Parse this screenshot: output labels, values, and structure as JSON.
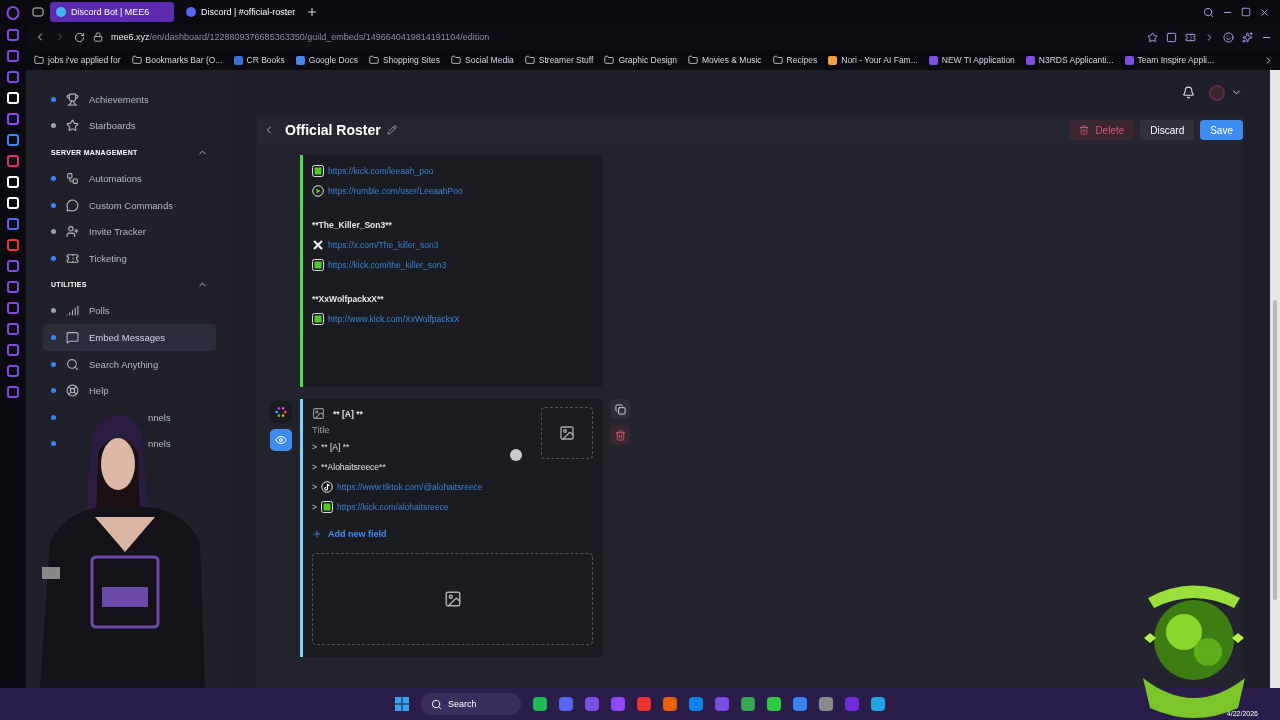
{
  "browser": {
    "tabs": [
      {
        "label": "Discord Bot | MEE6",
        "selected": true
      },
      {
        "label": "Discord | #official-roster",
        "selected": false
      }
    ],
    "url": {
      "host": "mee6.xyz",
      "path": "/en/dashboard/1228809376685363350/guild_embeds/1496640419814191104/edition"
    },
    "bookmarks": [
      {
        "label": "jobs i've applied for",
        "kind": "folder"
      },
      {
        "label": "Bookmarks Bar (O...",
        "kind": "folder"
      },
      {
        "label": "CR Books",
        "kind": "site"
      },
      {
        "label": "Google Docs",
        "kind": "site"
      },
      {
        "label": "Shopping Sites",
        "kind": "folder"
      },
      {
        "label": "Social Media",
        "kind": "folder"
      },
      {
        "label": "Streamer Stuff",
        "kind": "folder"
      },
      {
        "label": "Graphic Design",
        "kind": "folder"
      },
      {
        "label": "Movies & Music",
        "kind": "folder"
      },
      {
        "label": "Recipes",
        "kind": "folder"
      },
      {
        "label": "Nori - Your AI Fam...",
        "kind": "site"
      },
      {
        "label": "NEW TI Application",
        "kind": "site"
      },
      {
        "label": "N3RDS Applicanti...",
        "kind": "site"
      },
      {
        "label": "Team Inspire Appli...",
        "kind": "site"
      }
    ]
  },
  "sidebar": [
    {
      "kind": "item",
      "label": "Achievements",
      "color": "#3b82f6",
      "selected": false
    },
    {
      "kind": "item",
      "label": "Starboards",
      "color": "#9ca3af",
      "selected": false
    },
    {
      "kind": "section",
      "title": "SERVER MANAGEMENT",
      "expanded": true
    },
    {
      "kind": "item",
      "label": "Automations",
      "color": "#3b82f6",
      "selected": false
    },
    {
      "kind": "item",
      "label": "Custom Commands",
      "color": "#3b82f6",
      "selected": false
    },
    {
      "kind": "item",
      "label": "Invite Tracker",
      "color": "#9ca3af",
      "selected": false
    },
    {
      "kind": "item",
      "label": "Ticketing",
      "color": "#3b82f6",
      "selected": false
    },
    {
      "kind": "section",
      "title": "UTILITIES",
      "expanded": true
    },
    {
      "kind": "item",
      "label": "Polls",
      "color": "#9ca3af",
      "selected": false
    },
    {
      "kind": "item",
      "label": "Embed Messages",
      "color": "#3b82f6",
      "selected": true
    },
    {
      "kind": "item",
      "label": "Search Anything",
      "color": "#3b82f6",
      "selected": false
    },
    {
      "kind": "item",
      "label": "Help",
      "color": "#3b82f6",
      "selected": false
    },
    {
      "kind": "covered",
      "label": "nnels",
      "color": "#3b82f6",
      "selected": false
    },
    {
      "kind": "covered",
      "label": "nnels",
      "color": "#3b82f6",
      "selected": false
    }
  ],
  "page": {
    "title": "Official Roster",
    "actions": [
      {
        "label": "Delete",
        "kind": "danger"
      },
      {
        "label": "Discard",
        "kind": "secondary"
      },
      {
        "label": "Save",
        "kind": "primary"
      }
    ],
    "embeds": [
      {
        "color": "#4ade50",
        "lines": [
          {
            "kind": "kick",
            "text": "https://kick.com/leeaah_poo"
          },
          {
            "kind": "rumble",
            "text": "https://rumble.com/user/LeeaahPoo"
          },
          {
            "kind": "heading",
            "text": "**The_Killer_Son3**"
          },
          {
            "kind": "x",
            "text": "https://x.com/The_killer_son3"
          },
          {
            "kind": "kick",
            "text": "https://kick.com/the_killer_son3"
          },
          {
            "kind": "heading",
            "text": "**XxWolfpackxX**"
          },
          {
            "kind": "kick",
            "text": "http://www.kick.com/XxWolfpackxX"
          }
        ]
      },
      {
        "color": "#7dd3fc",
        "author": "** [A] **",
        "title_placeholder": "Title",
        "add_field": "Add new field",
        "lines": [
          {
            "kind": "text",
            "prefix": ">",
            "text": "** [A] **"
          },
          {
            "kind": "text",
            "prefix": ">",
            "text": "**Alohaitsreece**"
          },
          {
            "kind": "tiktok",
            "prefix": ">",
            "text": "https://www.tiktok.com/@alohaitsreece"
          },
          {
            "kind": "kick",
            "prefix": ">",
            "text": "https://kick.com/alohaitsreece"
          }
        ]
      }
    ]
  },
  "taskbar": {
    "search_placeholder": "Search",
    "date": "4/22/2026"
  }
}
